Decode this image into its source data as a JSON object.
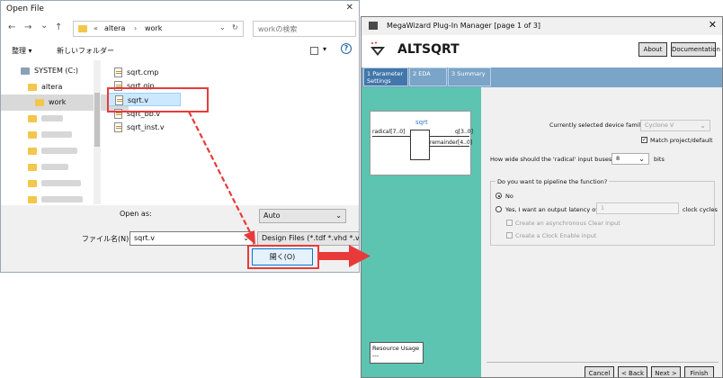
{
  "open_dialog": {
    "title": "Open File",
    "close_glyph": "✕",
    "nav": {
      "back": "←",
      "forward": "→",
      "dropdown": "⌄",
      "up": "↑"
    },
    "breadcrumb": {
      "prefix": "«",
      "items": [
        "altera",
        "work"
      ],
      "sep": "›"
    },
    "refresh_glyph": "↻",
    "search_placeholder": "workの検索",
    "toolbar": {
      "organize": "整理 ▾",
      "new_folder": "新しいフォルダー"
    },
    "tree": [
      {
        "label": "SYSTEM (C:)"
      },
      {
        "label": "altera"
      },
      {
        "label": "work"
      }
    ],
    "files": [
      "sqrt.cmp",
      "sqrt.qip",
      "sqrt.v",
      "sqrt_bb.v",
      "sqrt_inst.v"
    ],
    "selected_file": "sqrt.v",
    "open_as_label": "Open as:",
    "open_as_value": "Auto",
    "filename_label": "ファイル名(N):",
    "filename_value": "sqrt.v",
    "filetype_value": "Design Files (*.tdf *.vhd *.vhdl",
    "open_button": "開く(O)"
  },
  "megawizard": {
    "title": "MegaWizard Plug-In Manager [page 1 of 3]",
    "close_glyph": "✕",
    "function_name": "ALTSQRT",
    "about_button": "About",
    "documentation_button": "Documentation",
    "tabs": [
      {
        "num": "1",
        "label": "Parameter Settings"
      },
      {
        "num": "2",
        "label": "EDA"
      },
      {
        "num": "3",
        "label": "Summary"
      }
    ],
    "symbol": {
      "name": "sqrt",
      "in_port": "radical[7..0]",
      "out_q": "q[3..0]",
      "out_rem": "remainder[4..0]"
    },
    "resource_usage_label": "Resource Usage",
    "resource_usage_value": "---",
    "device_family_label": "Currently selected device family:",
    "device_family_value": "Cyclone V",
    "match_label": "Match project/default",
    "width_question": "How wide should the 'radical' input buses be?",
    "width_value": "8",
    "width_unit": "bits",
    "pipeline_question": "Do you want to pipeline the function?",
    "radio_no": "No",
    "radio_yes": "Yes, I want an output latency of",
    "latency_value": "1",
    "latency_unit": "clock cycles",
    "opt_aclr": "Create an asynchronous Clear input",
    "opt_clken": "Create a Clock Enable input",
    "buttons": {
      "cancel": "Cancel",
      "back": "< Back",
      "next": "Next >",
      "finish": "Finish"
    }
  },
  "colors": {
    "annotation_red": "#e83a3a",
    "teal_panel": "#5cc4b1",
    "tab_band": "#7aa4c8",
    "tab_active": "#4277aa",
    "selection": "#cce8ff"
  }
}
